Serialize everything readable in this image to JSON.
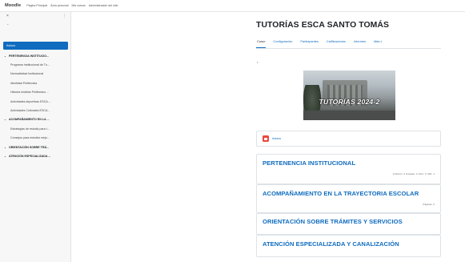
{
  "topbar": {
    "logo": "Moodle",
    "nav": [
      "Página Principal",
      "Área personal",
      "Mis cursos",
      "Administración del sitio"
    ]
  },
  "drawer": {
    "close_glyph": "×",
    "more_glyph": "⋮",
    "collapse_glyph": "⌄",
    "active_item": "Avisos",
    "items": [
      {
        "label": "PERTENENCIA INSTITUCIO...",
        "kind": "section"
      },
      {
        "label": "Programa Institucional de Tu...",
        "kind": "activity"
      },
      {
        "label": "Normatividad Institucional",
        "kind": "activity"
      },
      {
        "label": "Identidad Politécnica",
        "kind": "activity"
      },
      {
        "label": "Historia Instituto Politécnico ...",
        "kind": "activity"
      },
      {
        "label": "Actividades deportivas ESCA...",
        "kind": "activity"
      },
      {
        "label": "Actividades Culturales ESCA...",
        "kind": "activity"
      },
      {
        "label": "ACOMPAÑAMIENTO EN LA ...",
        "kind": "section"
      },
      {
        "label": "Estrategias de estudio para t...",
        "kind": "activity"
      },
      {
        "label": "Consejos para estudiar mejo...",
        "kind": "activity"
      },
      {
        "label": "ORIENTACIÓN SOBRE TRÁ...",
        "kind": "section"
      },
      {
        "label": "ATENCIÓN ESPECIALIZADA ...",
        "kind": "section"
      }
    ]
  },
  "course": {
    "title": "TUTORÍAS ESCA SANTO TOMÁS",
    "tabs": [
      "Curso",
      "Configuración",
      "Participantes",
      "Calificaciones",
      "Informes",
      "Más"
    ],
    "banner_text": "TUTORÍAS 2024-2",
    "announcements_label": "Avisos",
    "sections": [
      {
        "title": "PERTENENCIA INSTITUCIONAL",
        "meta": "Archivos: 4  Carpeta: 1  Libro: 1  URL: 1"
      },
      {
        "title": "ACOMPAÑAMIENTO EN LA TRAYECTORIA ESCOLAR",
        "meta": "Páginas: 2"
      },
      {
        "title": "ORIENTACIÓN SOBRE TRÁMITES Y SERVICIOS",
        "meta": ""
      },
      {
        "title": "ATENCIÓN ESPECIALIZADA Y CANALIZACIÓN",
        "meta": ""
      }
    ]
  },
  "colors": {
    "accent": "#0f6cbf",
    "forum_icon": "#e8493f",
    "drawer_bg": "#f7f7f7"
  }
}
